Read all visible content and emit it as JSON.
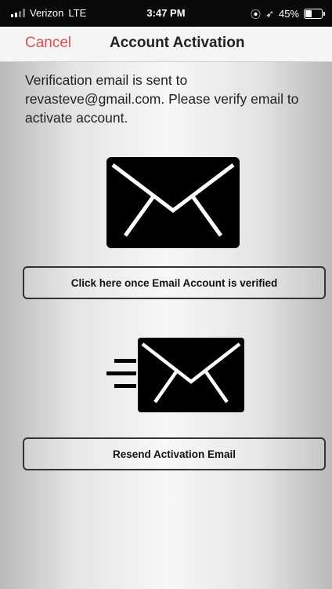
{
  "status_bar": {
    "carrier": "Verizon",
    "network": "LTE",
    "time": "3:47 PM",
    "location_icon": "⦿",
    "nav_icon": "➶",
    "battery_percent": "45%",
    "battery_level": 0.45
  },
  "nav": {
    "cancel_label": "Cancel",
    "title": "Account Activation"
  },
  "message": "Verification email is sent to revasteve@gmail.com. Please verify email to activate account.",
  "buttons": {
    "verify_label": "Click here once Email Account is verified",
    "resend_label": "Resend Activation Email"
  },
  "colors": {
    "cancel": "#d9534f",
    "icon": "#000000"
  },
  "icons": {
    "large": "envelope-icon",
    "small": "send-envelope-icon"
  }
}
